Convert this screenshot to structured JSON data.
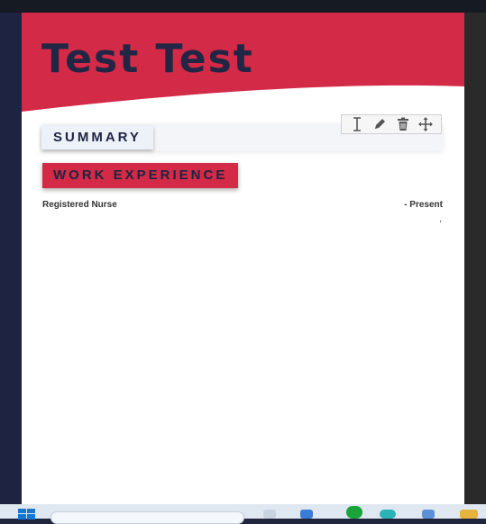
{
  "resume": {
    "name": "Test Test",
    "sections": {
      "summary_label": "SUMMARY",
      "work_label": "WORK EXPERIENCE"
    },
    "job": {
      "title": "Registered Nurse",
      "date": "- Present",
      "location": ","
    }
  },
  "toolbar": {
    "icons": [
      "text-cursor-icon",
      "pencil-icon",
      "trash-icon",
      "move-icon"
    ]
  },
  "colors": {
    "accent_red": "#d22a47",
    "navy": "#222644",
    "summary_bg": "#edf2f9"
  },
  "taskbar": {
    "icons": [
      "windows-icon",
      "search-box",
      "file-explorer-icon",
      "mail-icon",
      "app-icon",
      "edge-icon",
      "store-icon",
      "folder-icon"
    ]
  }
}
